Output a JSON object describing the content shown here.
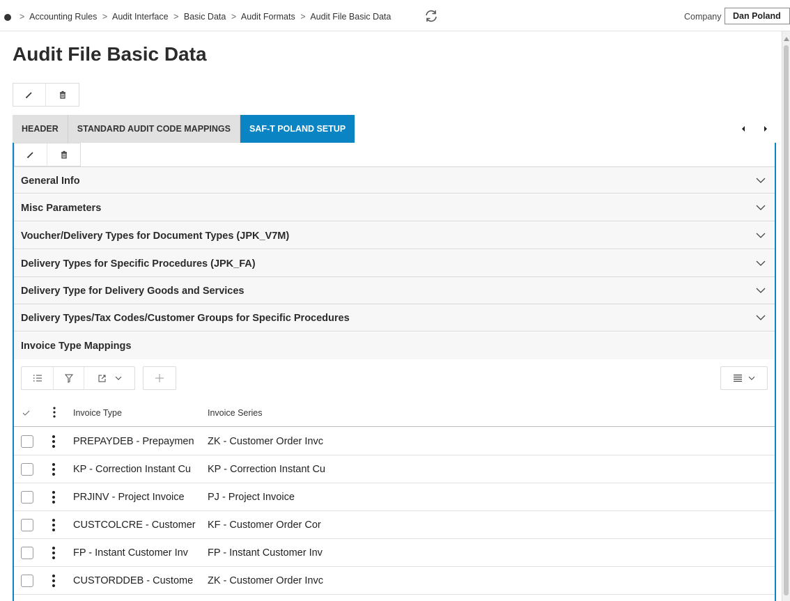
{
  "breadcrumb": {
    "items": [
      "Accounting Rules",
      "Audit Interface",
      "Basic Data",
      "Audit Formats",
      "Audit File Basic Data"
    ],
    "separator": ">"
  },
  "company": {
    "label": "Company",
    "value": "Dan Poland"
  },
  "page": {
    "title": "Audit File Basic Data"
  },
  "tabs": [
    {
      "label": "HEADER",
      "active": false
    },
    {
      "label": "STANDARD AUDIT CODE MAPPINGS",
      "active": false
    },
    {
      "label": "SAF-T POLAND SETUP",
      "active": true
    }
  ],
  "sections": [
    {
      "title": "General Info"
    },
    {
      "title": "Misc Parameters"
    },
    {
      "title": "Voucher/Delivery Types for Document Types (JPK_V7M)"
    },
    {
      "title": "Delivery Types for Specific Procedures (JPK_FA)"
    },
    {
      "title": "Delivery Type for Delivery Goods and Services"
    },
    {
      "title": "Delivery Types/Tax Codes/Customer Groups for Specific Procedures"
    }
  ],
  "invoice_mappings": {
    "title": "Invoice Type Mappings",
    "columns": [
      "Invoice Type",
      "Invoice Series"
    ],
    "rows": [
      {
        "invoice_type": "PREPAYDEB - Prepaymen",
        "invoice_series": "ZK - Customer Order Invc"
      },
      {
        "invoice_type": "KP - Correction Instant Cu",
        "invoice_series": "KP - Correction Instant Cu"
      },
      {
        "invoice_type": "PRJINV - Project Invoice",
        "invoice_series": "PJ - Project Invoice"
      },
      {
        "invoice_type": "CUSTCOLCRE - Customer",
        "invoice_series": "KF - Customer Order Cor"
      },
      {
        "invoice_type": "FP - Instant Customer Inv",
        "invoice_series": "FP - Instant Customer Inv"
      },
      {
        "invoice_type": "CUSTORDDEB - Custome",
        "invoice_series": "ZK - Customer Order Invc"
      }
    ]
  },
  "colors": {
    "accent": "#0a84c2",
    "tab_bg": "#e1e1e1",
    "section_bg": "#f7f7f7"
  }
}
